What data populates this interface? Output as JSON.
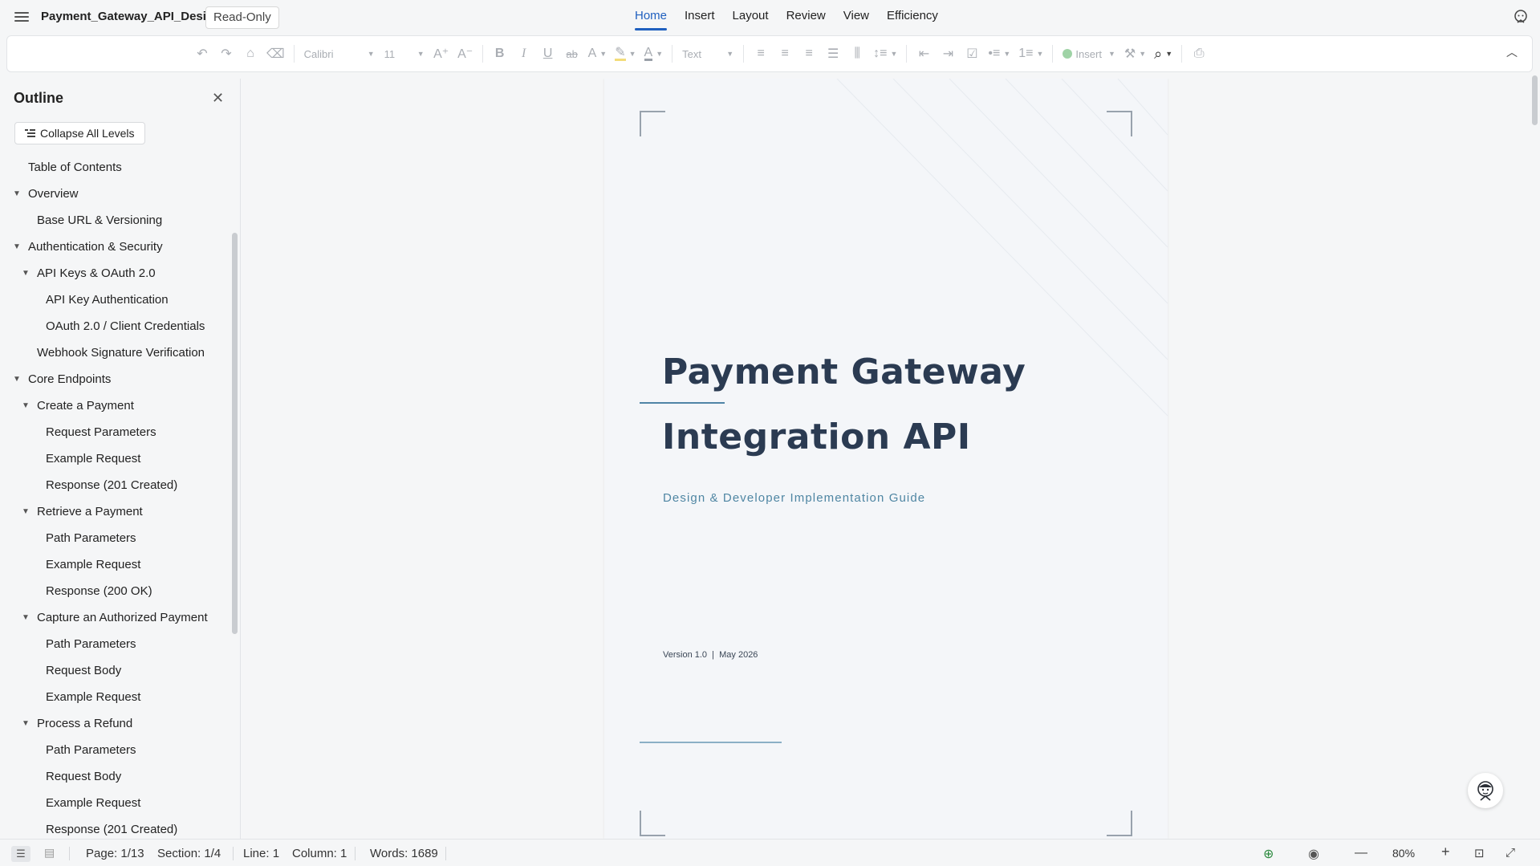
{
  "app": {
    "doc_name": "Payment_Gateway_API_Design",
    "mode_badge": "Read-Only"
  },
  "menu": {
    "tabs": [
      "Home",
      "Insert",
      "Layout",
      "Review",
      "View",
      "Efficiency"
    ],
    "active": "Home"
  },
  "toolbar": {
    "font_family": "Calibri",
    "font_size": "11",
    "style": "Text",
    "insert_label": "Insert"
  },
  "outline": {
    "title": "Outline",
    "collapse_label": "Collapse All Levels",
    "items": [
      {
        "label": "Table of Contents",
        "level": 1,
        "expandable": false
      },
      {
        "label": "Overview",
        "level": 1,
        "expandable": true
      },
      {
        "label": "Base URL & Versioning",
        "level": 2,
        "expandable": false
      },
      {
        "label": "Authentication & Security",
        "level": 1,
        "expandable": true
      },
      {
        "label": "API Keys & OAuth 2.0",
        "level": 2,
        "expandable": true
      },
      {
        "label": "API Key Authentication",
        "level": 3,
        "expandable": false
      },
      {
        "label": "OAuth 2.0 / Client Credentials",
        "level": 3,
        "expandable": false
      },
      {
        "label": "Webhook Signature Verification",
        "level": 2,
        "expandable": false
      },
      {
        "label": "Core Endpoints",
        "level": 1,
        "expandable": true
      },
      {
        "label": "Create a Payment",
        "level": 2,
        "expandable": true
      },
      {
        "label": "Request Parameters",
        "level": 3,
        "expandable": false
      },
      {
        "label": "Example Request",
        "level": 3,
        "expandable": false
      },
      {
        "label": "Response (201 Created)",
        "level": 3,
        "expandable": false
      },
      {
        "label": "Retrieve a Payment",
        "level": 2,
        "expandable": true
      },
      {
        "label": "Path Parameters",
        "level": 3,
        "expandable": false
      },
      {
        "label": "Example Request",
        "level": 3,
        "expandable": false
      },
      {
        "label": "Response (200 OK)",
        "level": 3,
        "expandable": false
      },
      {
        "label": "Capture an Authorized Payment",
        "level": 2,
        "expandable": true
      },
      {
        "label": "Path Parameters",
        "level": 3,
        "expandable": false
      },
      {
        "label": "Request Body",
        "level": 3,
        "expandable": false
      },
      {
        "label": "Example Request",
        "level": 3,
        "expandable": false
      },
      {
        "label": "Process a Refund",
        "level": 2,
        "expandable": true
      },
      {
        "label": "Path Parameters",
        "level": 3,
        "expandable": false
      },
      {
        "label": "Request Body",
        "level": 3,
        "expandable": false
      },
      {
        "label": "Example Request",
        "level": 3,
        "expandable": false
      },
      {
        "label": "Response (201 Created)",
        "level": 3,
        "expandable": false
      }
    ]
  },
  "page": {
    "title_line1": "Payment Gateway",
    "title_line2": "Integration API",
    "subtitle": "Design & Developer Implementation Guide",
    "version": "Version 1.0  |  May 2026"
  },
  "status": {
    "page": "Page: 1/13",
    "section": "Section: 1/4",
    "line": "Line: 1",
    "column": "Column: 1",
    "words": "Words: 1689",
    "zoom": "80%"
  },
  "colors": {
    "accent": "#1f5fbf",
    "title": "#2b3b52",
    "subtitle": "#4f86a3"
  }
}
